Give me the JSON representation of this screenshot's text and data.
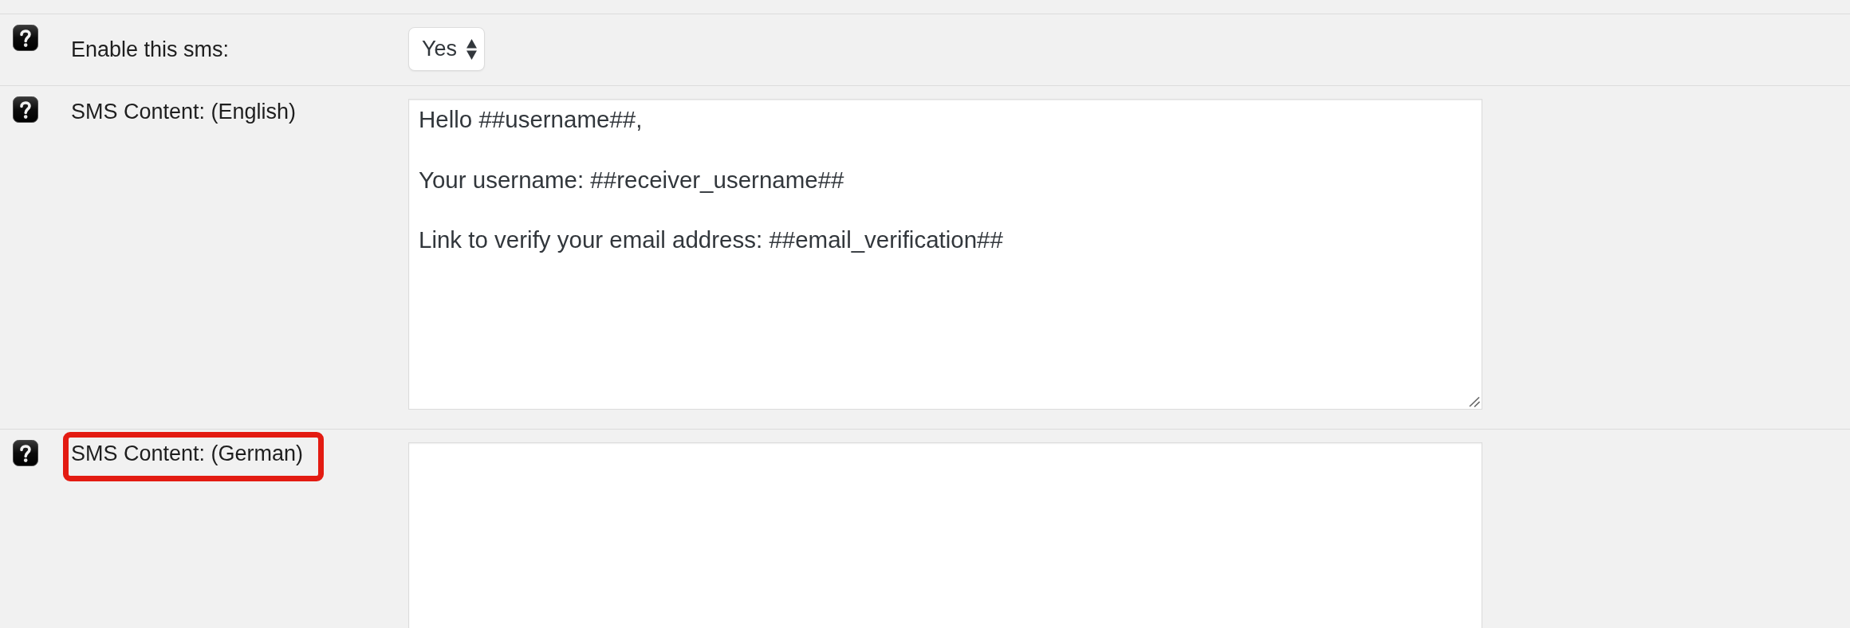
{
  "fields": [
    {
      "kind": "select",
      "label": "Enable this sms:",
      "value": "Yes",
      "highlighted": false
    },
    {
      "kind": "textarea",
      "label": "SMS Content: (English)",
      "value": "Hello ##username##,\n\nYour username: ##receiver_username##\n\nLink to verify your email address: ##email_verification##",
      "highlighted": false
    },
    {
      "kind": "textarea",
      "label": "SMS Content: (German)",
      "highlighted": true
    }
  ]
}
